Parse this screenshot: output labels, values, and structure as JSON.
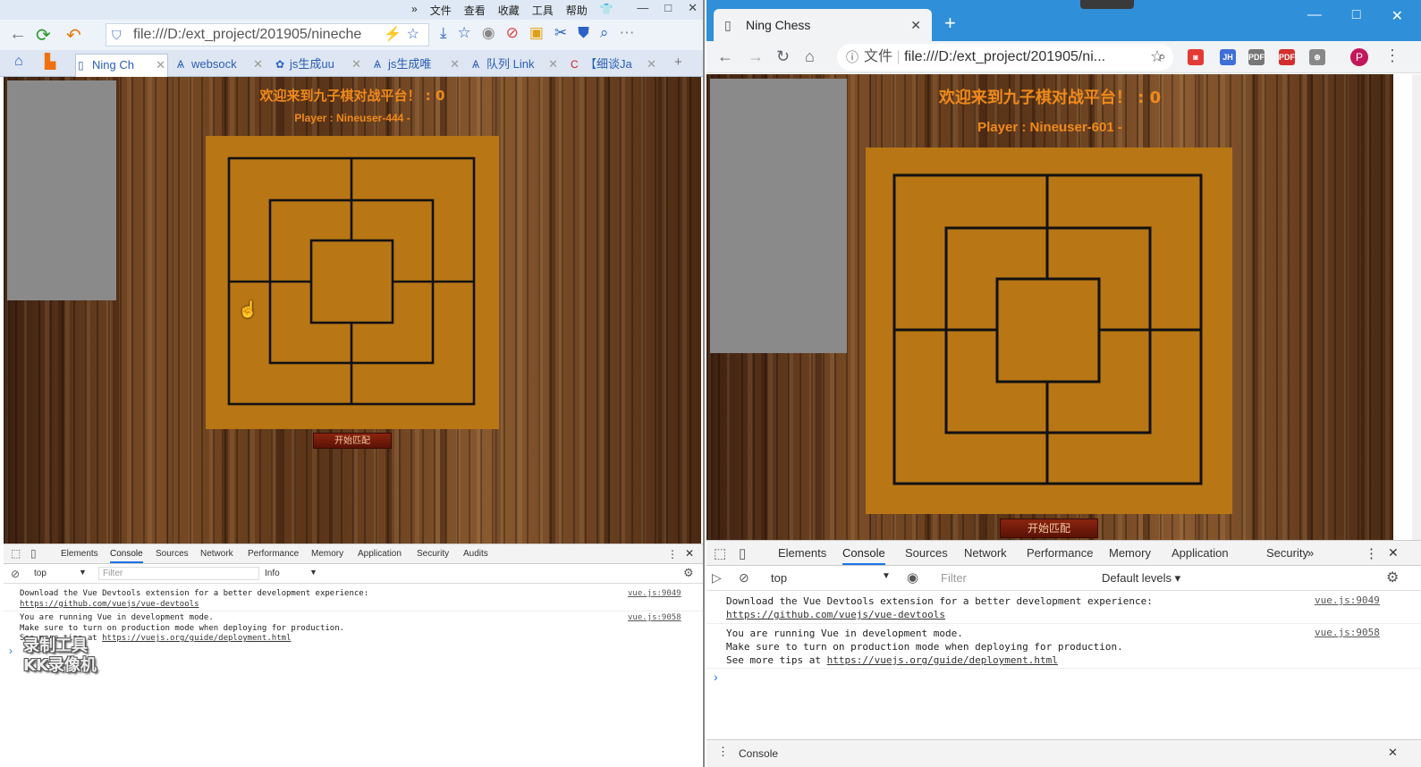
{
  "left_browser": {
    "menu": [
      "»",
      "文件",
      "查看",
      "收藏",
      "工具",
      "帮助"
    ],
    "window_buttons": [
      "—",
      "□",
      "✕"
    ],
    "url": "file:///D:/ext_project/201905/nineche",
    "tabs": [
      {
        "label": "Ning Ch"
      },
      {
        "label": "websock"
      },
      {
        "label": "js生成uu"
      },
      {
        "label": "js生成唯"
      },
      {
        "label": "队列 Link"
      },
      {
        "label": "【细谈Ja"
      }
    ],
    "new_tab": "+"
  },
  "right_browser": {
    "tab_title": "Ning Chess",
    "tab_close": "✕",
    "new_tab": "+",
    "window_buttons": [
      "—",
      "□",
      "✕"
    ],
    "url_prefix": "文件",
    "url": "file:///D:/ext_project/201905/ni...",
    "avatar": "P"
  },
  "game_left": {
    "welcome": "欢迎来到九子棋对战平台！ : 0",
    "player": "Player : Nineuser-444 -",
    "match_button": "开始匹配"
  },
  "game_right": {
    "welcome": "欢迎来到九子棋对战平台！ : 0",
    "player": "Player : Nineuser-601 -",
    "match_button": "开始匹配"
  },
  "devtools_left": {
    "tabs": [
      "Elements",
      "Console",
      "Sources",
      "Network",
      "Performance",
      "Memory",
      "Application",
      "Security",
      "Audits"
    ],
    "active_tab": "Console",
    "context": "top",
    "filter_placeholder": "Filter",
    "level": "Info",
    "log1_line1": "Download the Vue Devtools extension for a better development experience:",
    "log1_link": "https://github.com/vuejs/vue-devtools",
    "log1_src": "vue.js:9049",
    "log2_line1": "You are running Vue in development mode.",
    "log2_line2": "Make sure to turn on production mode when deploying for production.",
    "log2_line3_prefix": "See more tips at ",
    "log2_link": "https://vuejs.org/guide/deployment.html",
    "log2_src": "vue.js:9058",
    "prompt": "›"
  },
  "devtools_right": {
    "tabs": [
      "Elements",
      "Console",
      "Sources",
      "Network",
      "Performance",
      "Memory",
      "Application",
      "Security"
    ],
    "more_tabs": "»",
    "active_tab": "Console",
    "context": "top",
    "filter_placeholder": "Filter",
    "level": "Default levels ▾",
    "log1_line1": "Download the Vue Devtools extension for a better development experience:",
    "log1_link": "https://github.com/vuejs/vue-devtools",
    "log1_src": "vue.js:9049",
    "log2_line1": "You are running Vue in development mode.",
    "log2_line2": "Make sure to turn on production mode when deploying for production.",
    "log2_line3_prefix": "See more tips at ",
    "log2_link": "https://vuejs.org/guide/deployment.html",
    "log2_src": "vue.js:9058",
    "prompt": "›",
    "drawer_label": "Console"
  },
  "watermark": [
    "录制工具",
    "KK录像机"
  ],
  "colors": {
    "board": "#b87615",
    "title_orange": "#f08a1a",
    "button_red": "#8a2410",
    "right_titlebar": "#2f8fd8"
  }
}
